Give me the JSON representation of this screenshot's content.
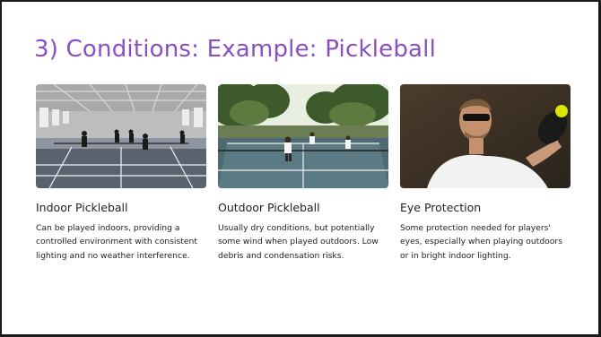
{
  "slide": {
    "title": "3) Conditions: Example: Pickleball"
  },
  "cards": [
    {
      "caption": "Indoor Pickleball",
      "description": "Can be played indoors, providing a controlled environment with consistent lighting and no weather interference."
    },
    {
      "caption": "Outdoor Pickleball",
      "description": "Usually dry conditions, but potentially some wind when played outdoors. Low debris and condensation risks."
    },
    {
      "caption": "Eye Protection",
      "description": "Some protection needed for players' eyes, especially when playing outdoors or in bright indoor lighting."
    }
  ],
  "colors": {
    "title": "#8a4fc0",
    "text": "#222222",
    "border": "#1a1a1a"
  }
}
